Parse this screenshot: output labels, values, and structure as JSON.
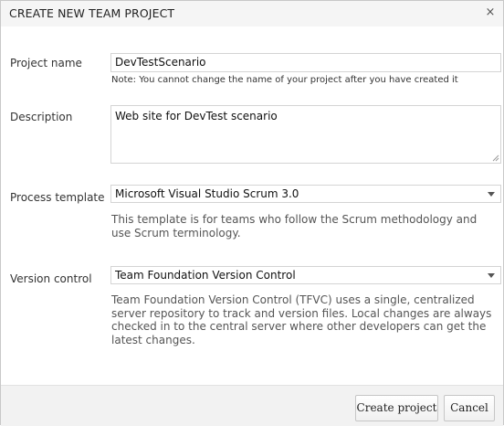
{
  "dialog": {
    "title": "CREATE NEW TEAM PROJECT",
    "close_icon": "close-icon",
    "close_glyph": "×"
  },
  "form": {
    "project_name": {
      "label": "Project name",
      "value": "DevTestScenario",
      "note": "Note: You cannot change the name of your project after you have created it"
    },
    "description": {
      "label": "Description",
      "value": "Web site for DevTest scenario"
    },
    "process_template": {
      "label": "Process template",
      "selected": "Microsoft Visual Studio Scrum 3.0",
      "help": "This template is for teams who follow the Scrum methodology and use Scrum terminology."
    },
    "version_control": {
      "label": "Version control",
      "selected": "Team Foundation Version Control",
      "help": "Team Foundation Version Control (TFVC) uses a single, centralized server repository to track and version files. Local changes are always checked in to the central server where other developers can get the latest changes."
    }
  },
  "footer": {
    "create_label": "Create project",
    "cancel_label": "Cancel"
  }
}
